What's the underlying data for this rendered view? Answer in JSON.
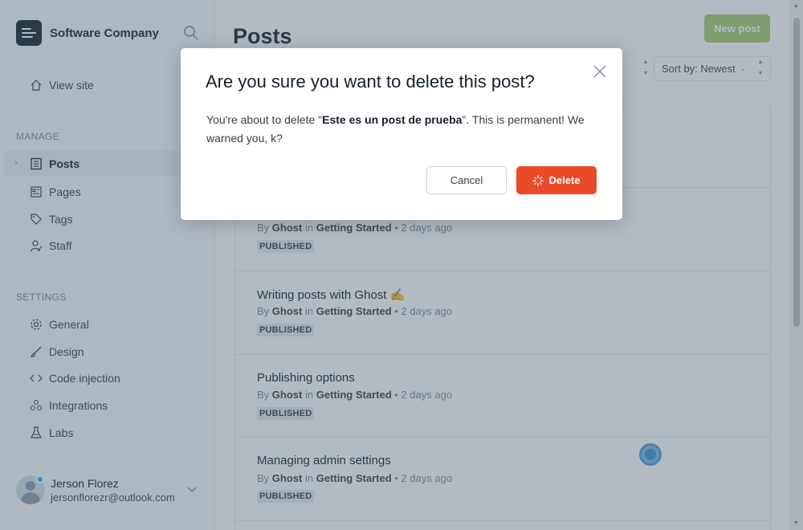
{
  "brand": {
    "name": "Software Company"
  },
  "sidebar": {
    "view_site": "View site",
    "manage_label": "MANAGE",
    "manage_items": [
      {
        "label": "Posts",
        "icon": "posts-icon",
        "active": true
      },
      {
        "label": "Pages",
        "icon": "pages-icon"
      },
      {
        "label": "Tags",
        "icon": "tag-icon"
      },
      {
        "label": "Staff",
        "icon": "staff-icon"
      }
    ],
    "settings_label": "SETTINGS",
    "settings_items": [
      {
        "label": "General",
        "icon": "gear-icon"
      },
      {
        "label": "Design",
        "icon": "brush-icon"
      },
      {
        "label": "Code injection",
        "icon": "code-icon"
      },
      {
        "label": "Integrations",
        "icon": "integrations-icon"
      },
      {
        "label": "Labs",
        "icon": "flask-icon"
      }
    ],
    "user": {
      "name": "Jerson Florez",
      "email": "jersonflorezr@outlook.com"
    }
  },
  "main": {
    "title": "Posts",
    "new_post": "New post",
    "sort_label": "Sort by: Newest",
    "posts": [
      {
        "title": "",
        "by": "By",
        "author": "Ghost",
        "in": "in",
        "tag": "Getting Started",
        "time": "• 2 days ago",
        "status": "PUBLISHED"
      },
      {
        "title": "Writing posts with Ghost ✍️",
        "by": "By",
        "author": "Ghost",
        "in": "in",
        "tag": "Getting Started",
        "time": "• 2 days ago",
        "status": "PUBLISHED"
      },
      {
        "title": "Publishing options",
        "by": "By",
        "author": "Ghost",
        "in": "in",
        "tag": "Getting Started",
        "time": "• 2 days ago",
        "status": "PUBLISHED"
      },
      {
        "title": "Managing admin settings",
        "by": "By",
        "author": "Ghost",
        "in": "in",
        "tag": "Getting Started",
        "time": "• 2 days ago",
        "status": "PUBLISHED"
      }
    ]
  },
  "modal": {
    "title": "Are you sure you want to delete this post?",
    "body_prefix": "You're about to delete \"",
    "post_name": "Este es un post de prueba",
    "body_suffix": "\". This is permanent! We warned you, k?",
    "cancel": "Cancel",
    "delete": "Delete"
  },
  "colors": {
    "accent": "#a5cd6f",
    "danger": "#e94a28",
    "text": "#15212a"
  }
}
